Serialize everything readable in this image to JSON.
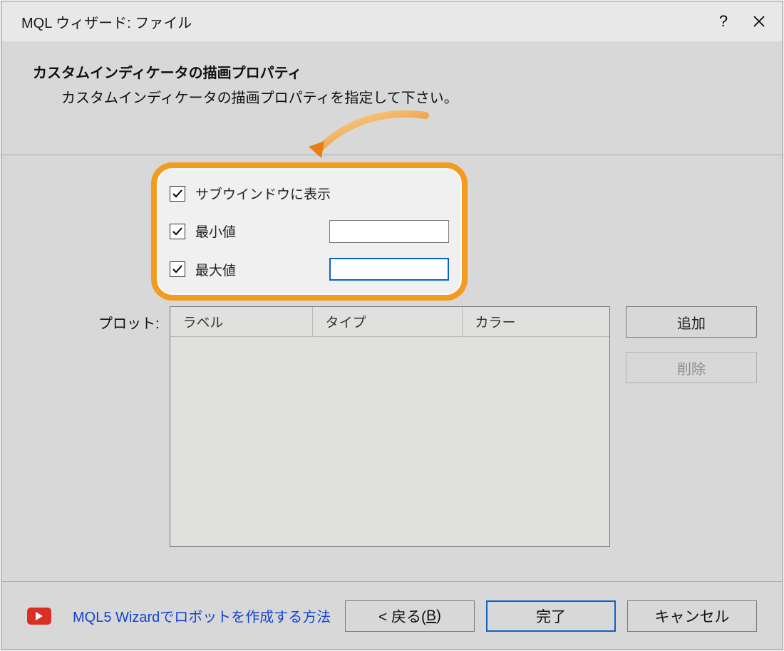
{
  "window": {
    "title": "MQL ウィザード: ファイル",
    "help": "?",
    "close": "✕"
  },
  "header": {
    "title": "カスタムインディケータの描画プロパティ",
    "subtitle": "カスタムインディケータの描画プロパティを指定して下さい。"
  },
  "callout": {
    "show_subwindow": {
      "label": "サブウインドウに表示",
      "checked": true
    },
    "min": {
      "label": "最小値",
      "checked": true,
      "value": ""
    },
    "max": {
      "label": "最大値",
      "checked": true,
      "value": ""
    }
  },
  "plot": {
    "label": "プロット:",
    "columns": [
      "ラベル",
      "タイプ",
      "カラー"
    ],
    "buttons": {
      "add": "追加",
      "delete": "削除"
    }
  },
  "footer": {
    "link": "MQL5 Wizardでロボットを作成する方法",
    "back_prefix": "< 戻る(",
    "back_key": "B",
    "back_suffix": ")",
    "finish": "完了",
    "cancel": "キャンセル"
  }
}
